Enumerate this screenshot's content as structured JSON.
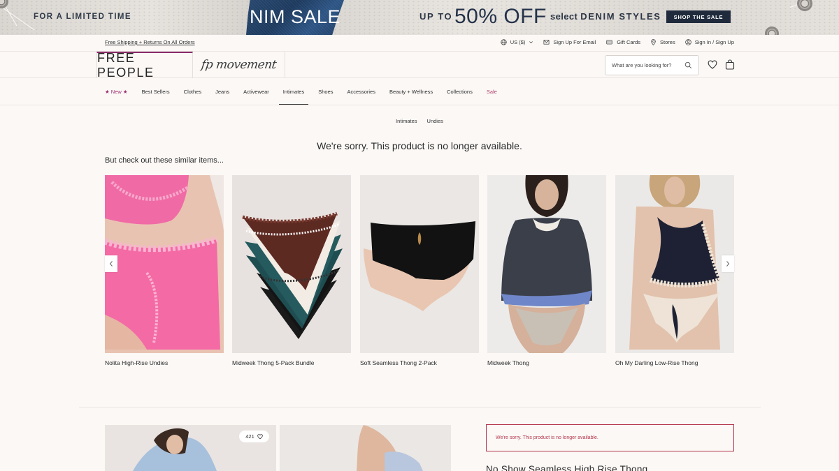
{
  "promo": {
    "left_text": "FOR A LIMITED TIME",
    "sale_text": "NIM SALE",
    "up_to": "UP TO",
    "percent": "50% OFF",
    "select": "select",
    "denim_styles": "DENIM STYLES",
    "button": "SHOP THE SALE"
  },
  "utility": {
    "shipping": "Free Shipping + Returns On All Orders",
    "links": {
      "currency": "US ($)",
      "email": "Sign Up For Email",
      "gift": "Gift Cards",
      "stores": "Stores",
      "signin": "Sign In / Sign Up"
    }
  },
  "brand": {
    "logo": "FREE PEOPLE",
    "movement": "fp movement"
  },
  "search": {
    "placeholder": "What are you looking for?"
  },
  "nav": {
    "items": [
      "★ New ★",
      "Best Sellers",
      "Clothes",
      "Jeans",
      "Activewear",
      "Intimates",
      "Shoes",
      "Accessories",
      "Beauty + Wellness",
      "Collections",
      "Sale"
    ]
  },
  "breadcrumb": [
    "Intimates",
    "Undies"
  ],
  "message": "We're sorry. This product is no longer available.",
  "similar_heading": "But check out these similar items...",
  "products": [
    {
      "title": "Nolita High-Rise Undies"
    },
    {
      "title": "Midweek Thong 5-Pack Bundle"
    },
    {
      "title": "Soft Seamless Thong 2-Pack"
    },
    {
      "title": "Midweek Thong"
    },
    {
      "title": "Oh My Darling Low-Rise Thong"
    }
  ],
  "bottom": {
    "likes": "421",
    "error": "We're sorry. This product is no longer available.",
    "product_title": "No Show Seamless High Rise Thong"
  }
}
